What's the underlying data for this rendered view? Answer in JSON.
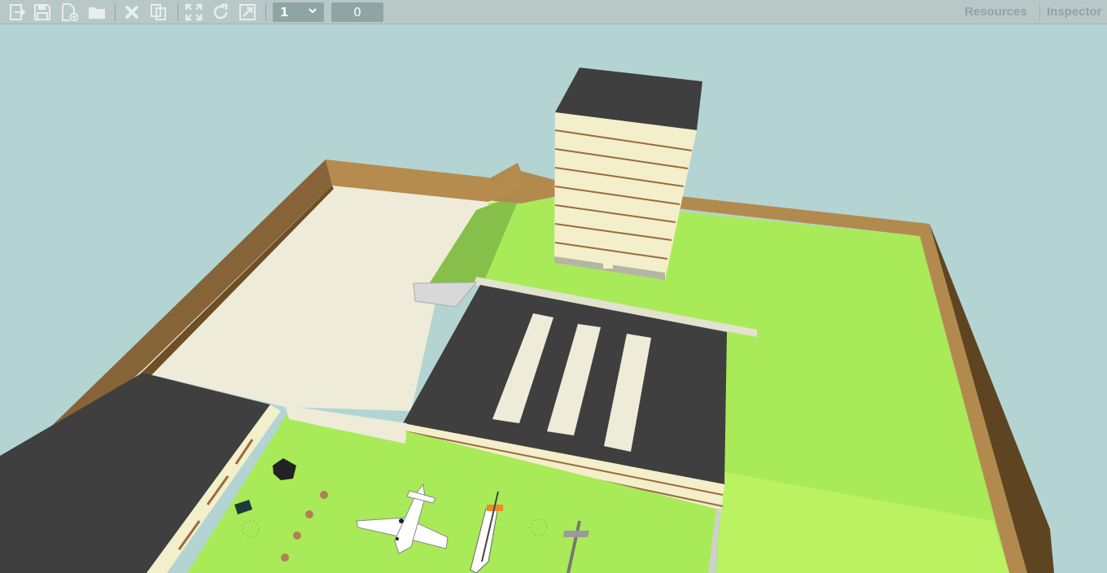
{
  "toolbar": {
    "buttons": [
      {
        "name": "export-icon"
      },
      {
        "name": "save-icon"
      },
      {
        "name": "new-file-icon"
      },
      {
        "name": "open-folder-icon"
      },
      {
        "name": "delete-icon"
      },
      {
        "name": "duplicate-icon"
      },
      {
        "name": "fullscreen-icon"
      },
      {
        "name": "rotate-icon"
      },
      {
        "name": "resize-icon"
      }
    ],
    "zoom_value": "1",
    "count_value": "0"
  },
  "tabs": {
    "resources": "Resources",
    "inspector": "Inspector"
  },
  "colors": {
    "sky": "#b3d4d3",
    "wall": "#b38a4d",
    "wall_dark": "#6f5226",
    "grass": "#a9ea58",
    "concrete": "#eeebd9",
    "roof": "#3f3f3f",
    "building_face": "#f3efca"
  }
}
